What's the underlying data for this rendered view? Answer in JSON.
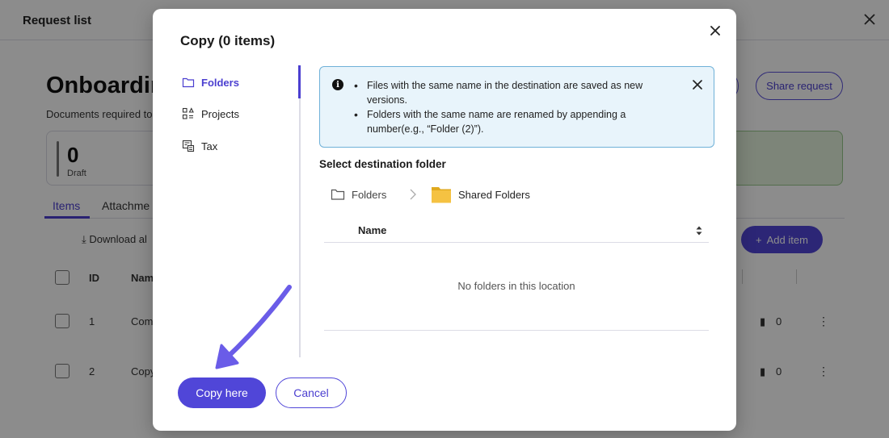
{
  "background": {
    "header_title": "Request list",
    "page_title": "Onboardin",
    "subtitle": "Documents required to",
    "share_button": "Share request",
    "stat": {
      "number": "0",
      "label": "Draft"
    },
    "tabs": [
      "Items",
      "Attachme"
    ],
    "download_label": "Download al",
    "add_item_label": "Add item",
    "columns": {
      "id": "ID",
      "name": "Nam"
    },
    "rows": [
      {
        "id": "1",
        "name": "Com",
        "count": "0"
      },
      {
        "id": "2",
        "name": "Copy",
        "count": "0"
      }
    ]
  },
  "dialog": {
    "title": "Copy (0 items)",
    "nav": [
      {
        "label": "Folders",
        "icon": "folder-icon",
        "active": true
      },
      {
        "label": "Projects",
        "icon": "projects-icon",
        "active": false
      },
      {
        "label": "Tax",
        "icon": "tax-icon",
        "active": false
      }
    ],
    "info": {
      "items": [
        "Files with the same name in the destination are saved as new versions.",
        "Folders with the same name are renamed by appending a number(e.g., “Folder (2)”)."
      ]
    },
    "section_label": "Select destination folder",
    "breadcrumb": {
      "root": "Folders",
      "current": "Shared Folders"
    },
    "table": {
      "column_name": "Name",
      "empty_message": "No folders in this location"
    },
    "buttons": {
      "primary": "Copy here",
      "secondary": "Cancel"
    }
  },
  "colors": {
    "accent": "#5046d8",
    "info_bg": "#e8f4fb",
    "info_border": "#6fb1d8",
    "folder_yellow": "#f5c242",
    "annotation_arrow": "#6a5ce8"
  }
}
